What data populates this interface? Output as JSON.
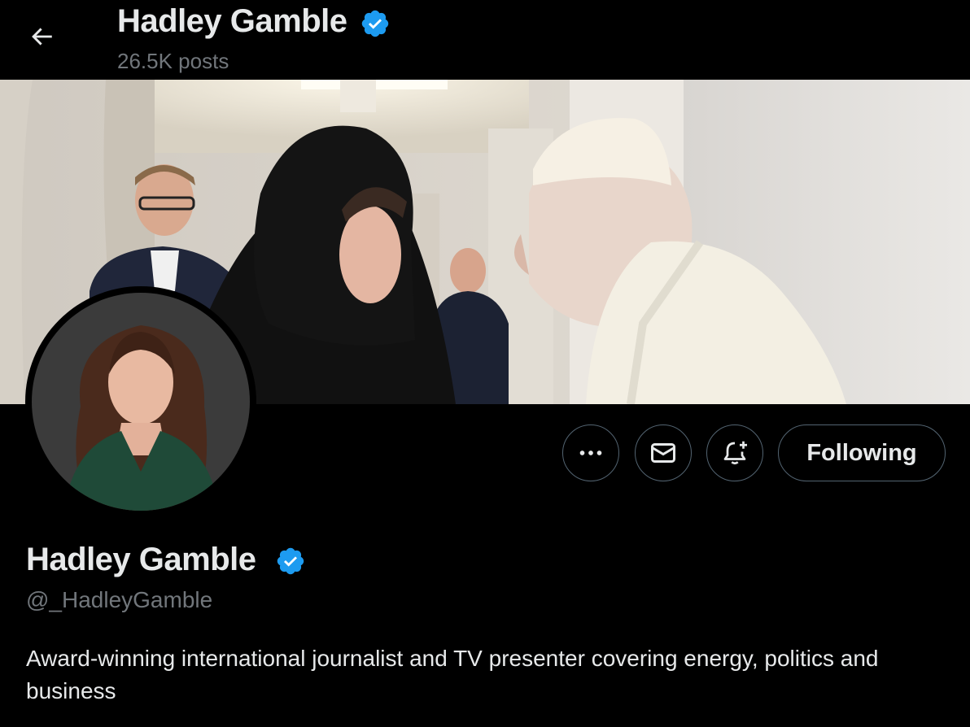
{
  "header": {
    "display_name": "Hadley Gamble",
    "post_count": "26.5K posts"
  },
  "actions": {
    "follow_label": "Following"
  },
  "profile": {
    "display_name": "Hadley Gamble",
    "handle": "@_HadleyGamble",
    "bio": "Award-winning international journalist and TV presenter covering energy, politics and business",
    "verified": true
  },
  "icons": {
    "back": "arrow-left-icon",
    "verified": "verified-badge-icon",
    "more": "more-horizontal-icon",
    "message": "envelope-icon",
    "notify": "bell-plus-icon"
  },
  "colors": {
    "background": "#000000",
    "text": "#e7e9ea",
    "secondary_text": "#71767b",
    "verified_blue": "#1d9bf0",
    "button_border": "#536471"
  }
}
